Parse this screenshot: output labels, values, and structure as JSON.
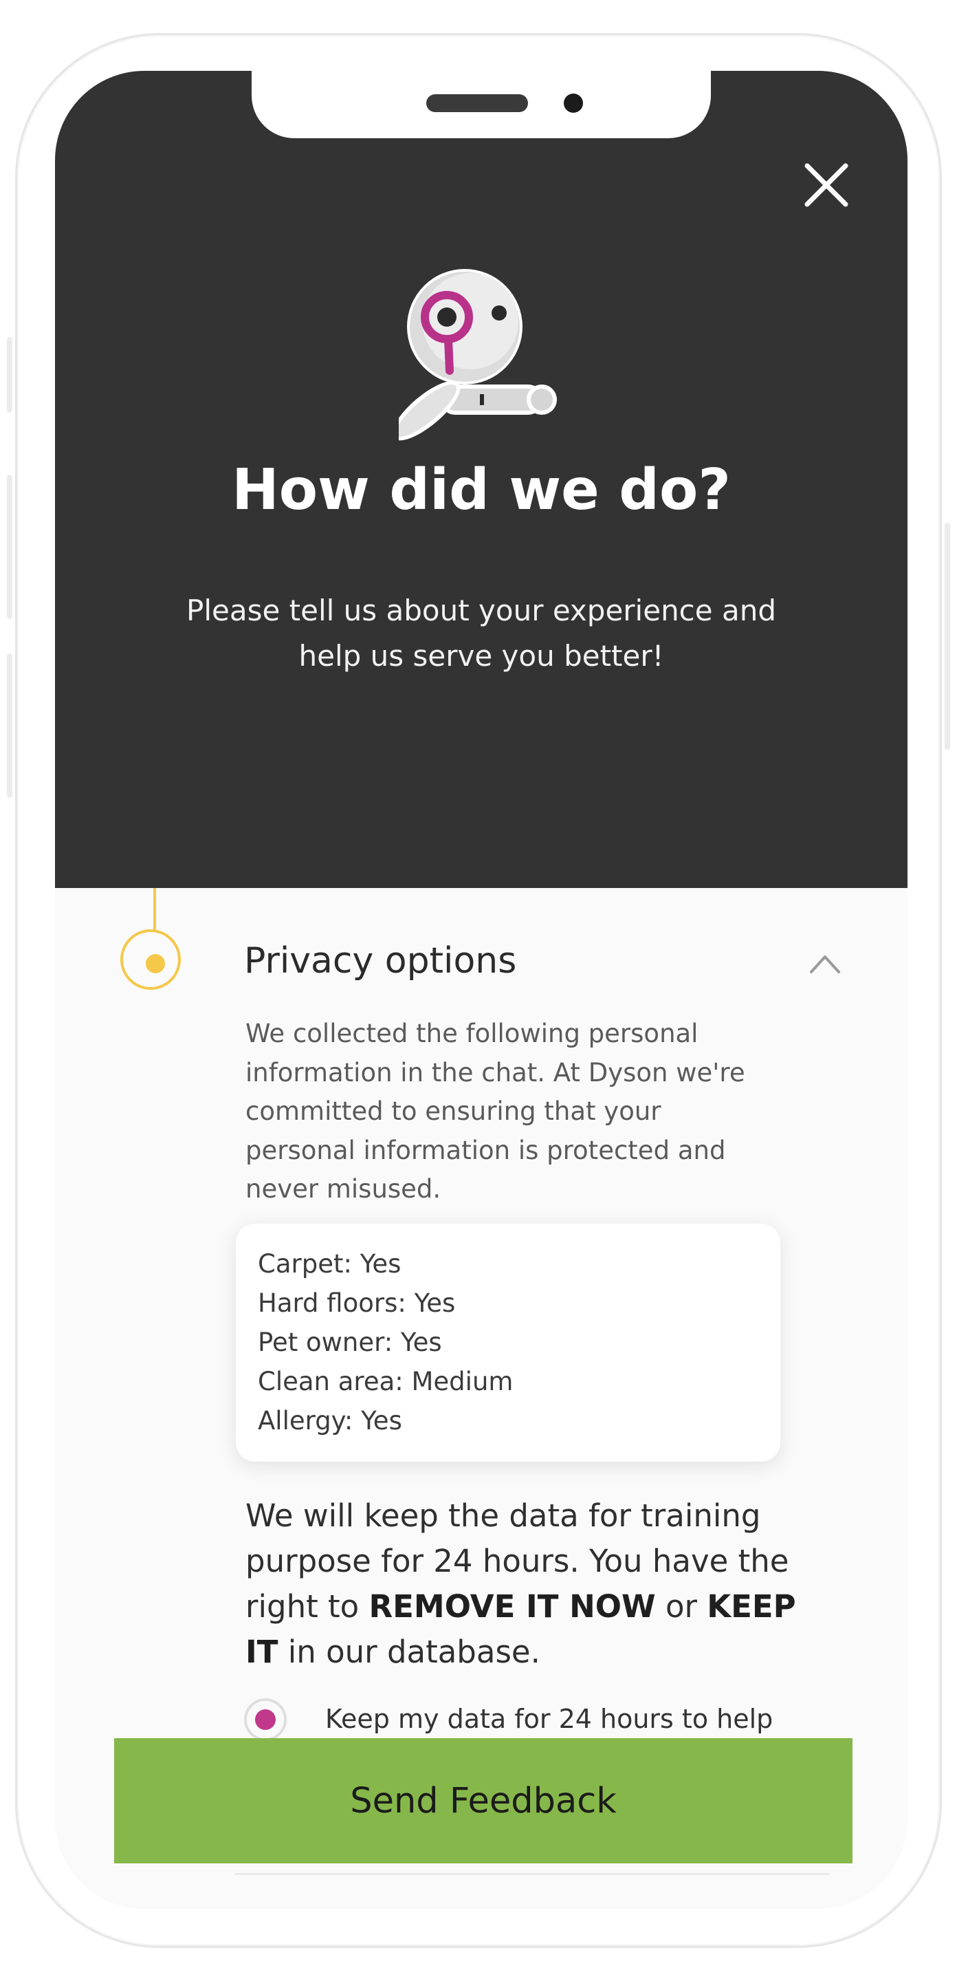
{
  "header": {
    "title": "How did we do?",
    "subtitle": "Please tell us about your experience and help us serve you better!",
    "close_icon": "close-icon",
    "mascot_icon": "robot-mascot-icon"
  },
  "privacy": {
    "title": "Privacy options",
    "description": "We collected the following personal information in the chat. At Dyson we're committed to ensuring that your personal information is protected and never misused.",
    "items": [
      {
        "label": "Carpet: Yes"
      },
      {
        "label": "Hard floors: Yes"
      },
      {
        "label": "Pet owner: Yes"
      },
      {
        "label": "Clean area: Medium"
      },
      {
        "label": "Allergy: Yes"
      }
    ],
    "retention": {
      "part1": "We will keep the data for training purpose for 24 hours. You have the right to ",
      "remove": "REMOVE IT NOW",
      "part2": " or ",
      "keep": "KEEP IT",
      "part3": " in our database."
    },
    "option_keep": "Keep my data for 24 hours to help"
  },
  "footer": {
    "send_label": "Send Feedback"
  },
  "colors": {
    "header_bg": "#333333",
    "accent_yellow": "#f5c84a",
    "radio_magenta": "#c0398a",
    "button_green": "#86b74b"
  }
}
